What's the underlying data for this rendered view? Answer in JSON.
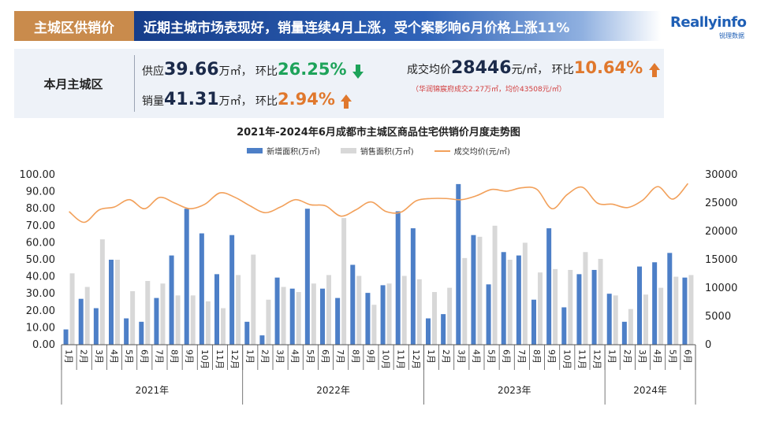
{
  "header": {
    "tag": "主城区供销价",
    "headline": "近期主城市场表现好，销量连续4月上涨，受个案影响6月价格上涨11%"
  },
  "logo": {
    "name": "Reallyinfo",
    "sub": "锐理数据",
    "color": "#1f5fb5"
  },
  "summary": {
    "label": "本月主城区",
    "supply_prefix": "供应",
    "supply_value": "39.66",
    "supply_unit": "万㎡，",
    "supply_mom_label": "环比",
    "supply_mom": "26.25%",
    "supply_dir": "down",
    "sales_prefix": "销量",
    "sales_value": "41.31",
    "sales_unit": "万㎡，",
    "sales_mom_label": "环比",
    "sales_mom": "2.94%",
    "sales_dir": "up",
    "price_prefix": "成交均价",
    "price_value": "28446",
    "price_unit": "元/㎡，",
    "price_mom_label": "环比",
    "price_mom": "10.64%",
    "price_dir": "up",
    "note": "（华润锦宸府成交2.27万㎡，均价43508元/㎡）"
  },
  "colors": {
    "supply": "#4d7fc7",
    "sales": "#d8d8d8",
    "price": "#f2a05a",
    "green": "#1ea35a",
    "orange": "#e0782d"
  },
  "chart_data": {
    "type": "bar",
    "title": "2021年-2024年6月成都市主城区商品住宅供销价月度走势图",
    "legend": [
      "新增面积(万㎡)",
      "销售面积(万㎡)",
      "成交均价(元/㎡)"
    ],
    "legend_position": "top",
    "grid": false,
    "y_left_ticks": [
      "0.00",
      "10.00",
      "20.00",
      "30.00",
      "40.00",
      "50.00",
      "60.00",
      "70.00",
      "80.00",
      "90.00",
      "100.00"
    ],
    "y_right_ticks": [
      "0",
      "5000",
      "10000",
      "15000",
      "20000",
      "25000",
      "30000"
    ],
    "ylim_left": [
      0,
      100
    ],
    "ylim_right": [
      0,
      30000
    ],
    "years": [
      {
        "label": "2021年",
        "months": 12
      },
      {
        "label": "2022年",
        "months": 12
      },
      {
        "label": "2023年",
        "months": 12
      },
      {
        "label": "2024年",
        "months": 6
      }
    ],
    "categories": [
      "1月",
      "2月",
      "3月",
      "4月",
      "5月",
      "6月",
      "7月",
      "8月",
      "9月",
      "10月",
      "11月",
      "12月",
      "1月",
      "2月",
      "3月",
      "4月",
      "5月",
      "6月",
      "7月",
      "8月",
      "9月",
      "10月",
      "11月",
      "12月",
      "1月",
      "2月",
      "3月",
      "4月",
      "5月",
      "6月",
      "7月",
      "8月",
      "9月",
      "10月",
      "11月",
      "12月",
      "1月",
      "2月",
      "3月",
      "4月",
      "5月",
      "6月"
    ],
    "series": [
      {
        "name": "新增面积(万㎡)",
        "type": "bar",
        "axis": "left",
        "values": [
          9,
          27,
          21.5,
          50,
          15.5,
          13.5,
          27.5,
          52.5,
          80,
          65.5,
          41.5,
          64.5,
          13.5,
          5.5,
          39.5,
          33,
          80,
          33,
          27.5,
          47,
          30.5,
          35,
          78.5,
          68.5,
          15.5,
          18,
          94.5,
          64.5,
          35.5,
          54.5,
          52.5,
          26.5,
          68.5,
          22,
          41.5,
          44,
          30,
          13.5,
          46,
          48.5,
          54,
          39.5
        ]
      },
      {
        "name": "销售面积(万㎡)",
        "type": "bar",
        "axis": "left",
        "values": [
          42,
          34,
          62,
          50,
          31.5,
          37.5,
          36,
          29,
          29,
          25.5,
          21.5,
          41,
          53,
          26.5,
          34,
          31,
          36,
          41,
          74.5,
          40.5,
          23.5,
          36,
          40.5,
          38.5,
          31,
          33.5,
          51,
          63.5,
          70,
          50,
          60,
          42.5,
          44.5,
          44,
          54.5,
          50.5,
          29,
          21,
          29.5,
          33.5,
          40,
          41
        ]
      },
      {
        "name": "成交均价(元/㎡)",
        "type": "line",
        "axis": "right",
        "values": [
          23500,
          21600,
          23800,
          24300,
          25600,
          24000,
          26000,
          25000,
          24000,
          24800,
          26800,
          26000,
          24500,
          23300,
          24300,
          25600,
          24700,
          24500,
          22700,
          23800,
          25200,
          23500,
          23400,
          25400,
          25800,
          25800,
          25600,
          26300,
          27400,
          27100,
          27700,
          27400,
          24000,
          26500,
          27800,
          25000,
          24800,
          24200,
          25500,
          27900,
          25700,
          28446
        ]
      }
    ]
  }
}
